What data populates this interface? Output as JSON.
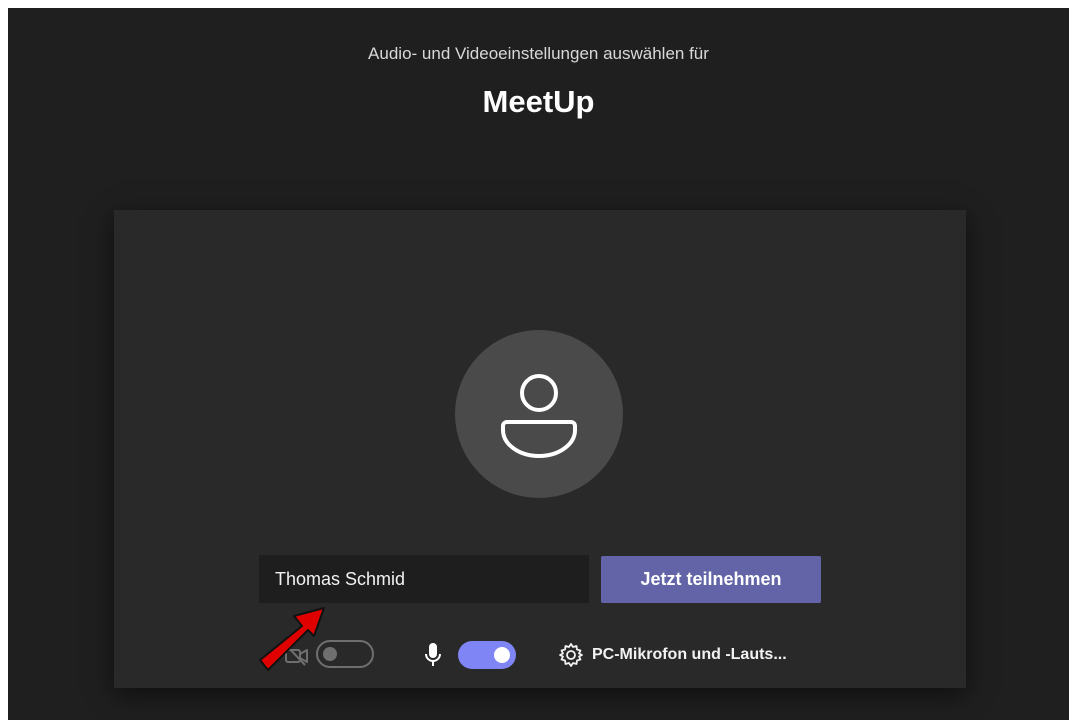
{
  "header": {
    "subtitle": "Audio- und Videoeinstellungen auswählen für",
    "meeting_title": "MeetUp"
  },
  "prejoin": {
    "avatar_icon": "person-icon",
    "name_input": {
      "value": "Thomas Schmid"
    },
    "join_button_label": "Jetzt teilnehmen"
  },
  "controls": {
    "camera_icon": "camera-off-icon",
    "camera_toggle_state": "off",
    "mic_icon": "microphone-icon",
    "mic_toggle_state": "on",
    "settings_icon": "gear-icon",
    "device_label": "PC-Mikrofon und -Lauts..."
  },
  "annotation": {
    "arrow_icon": "red-arrow-icon",
    "color": "#e00000"
  },
  "colors": {
    "background": "#1f1f1f",
    "panel": "#292929",
    "accent": "#6264a7",
    "toggle_on": "#7f85f5"
  }
}
